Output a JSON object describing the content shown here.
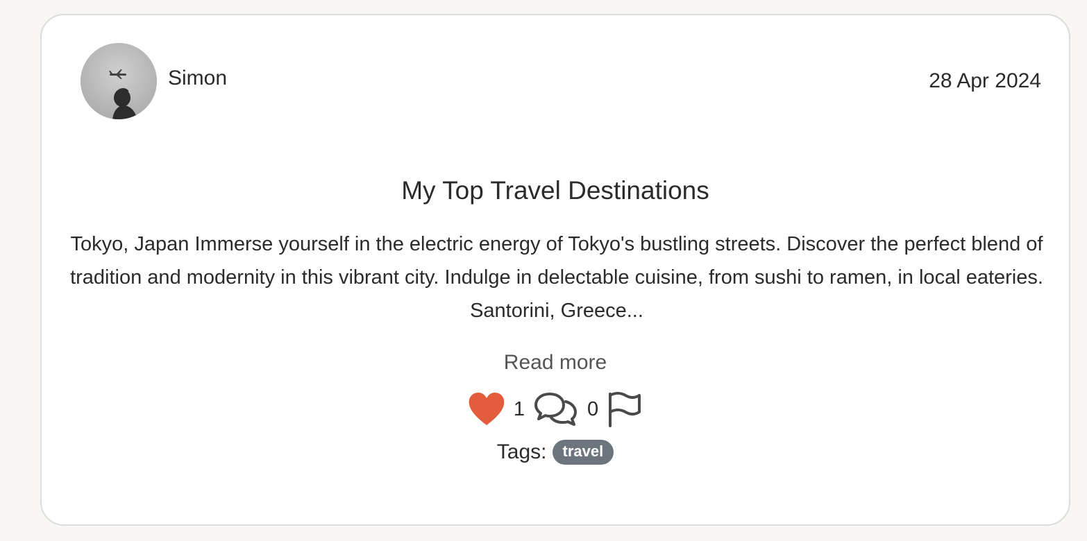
{
  "post": {
    "author": {
      "name": "Simon",
      "avatar_icon": "avatar-photo-airplane"
    },
    "date": "28 Apr 2024",
    "title": "My Top Travel Destinations",
    "excerpt": "Tokyo, Japan Immerse yourself in the electric energy of Tokyo's bustling streets. Discover the perfect blend of tradition and modernity in this vibrant city. Indulge in delectable cuisine, from sushi to ramen, in local eateries. Santorini, Greece...",
    "read_more_label": "Read more",
    "likes": {
      "icon": "heart-icon",
      "count": "1",
      "color": "#e35d3d",
      "liked": true
    },
    "comments": {
      "icon": "comments-icon",
      "count": "0"
    },
    "report": {
      "icon": "flag-icon"
    },
    "tags_label": "Tags:",
    "tags": [
      "travel"
    ],
    "tag_color": "#6c757d"
  }
}
